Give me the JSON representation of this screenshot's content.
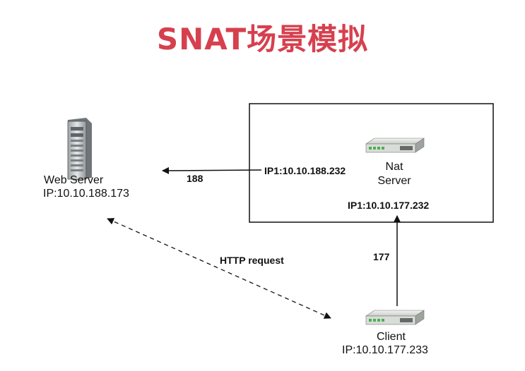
{
  "title": "SNAT场景模拟",
  "colors": {
    "title": "#d6404e",
    "line": "#111111",
    "box": "#111111",
    "device_body": "#d9ddd9",
    "device_led": "#4caf50"
  },
  "web_server": {
    "icon": "server-tower-icon",
    "name": "Web Server",
    "ip": "IP:10.10.188.173"
  },
  "nat_server": {
    "icon": "network-switch-icon",
    "name_line1": "Nat",
    "name_line2": "Server",
    "ip1": "IP1:10.10.188.232",
    "ip2": "IP1:10.10.177.232"
  },
  "client": {
    "icon": "network-switch-icon",
    "name": "Client",
    "ip": "IP:10.10.177.233"
  },
  "links": {
    "nat_to_web": "188",
    "client_to_nat": "177",
    "http": "HTTP request"
  }
}
